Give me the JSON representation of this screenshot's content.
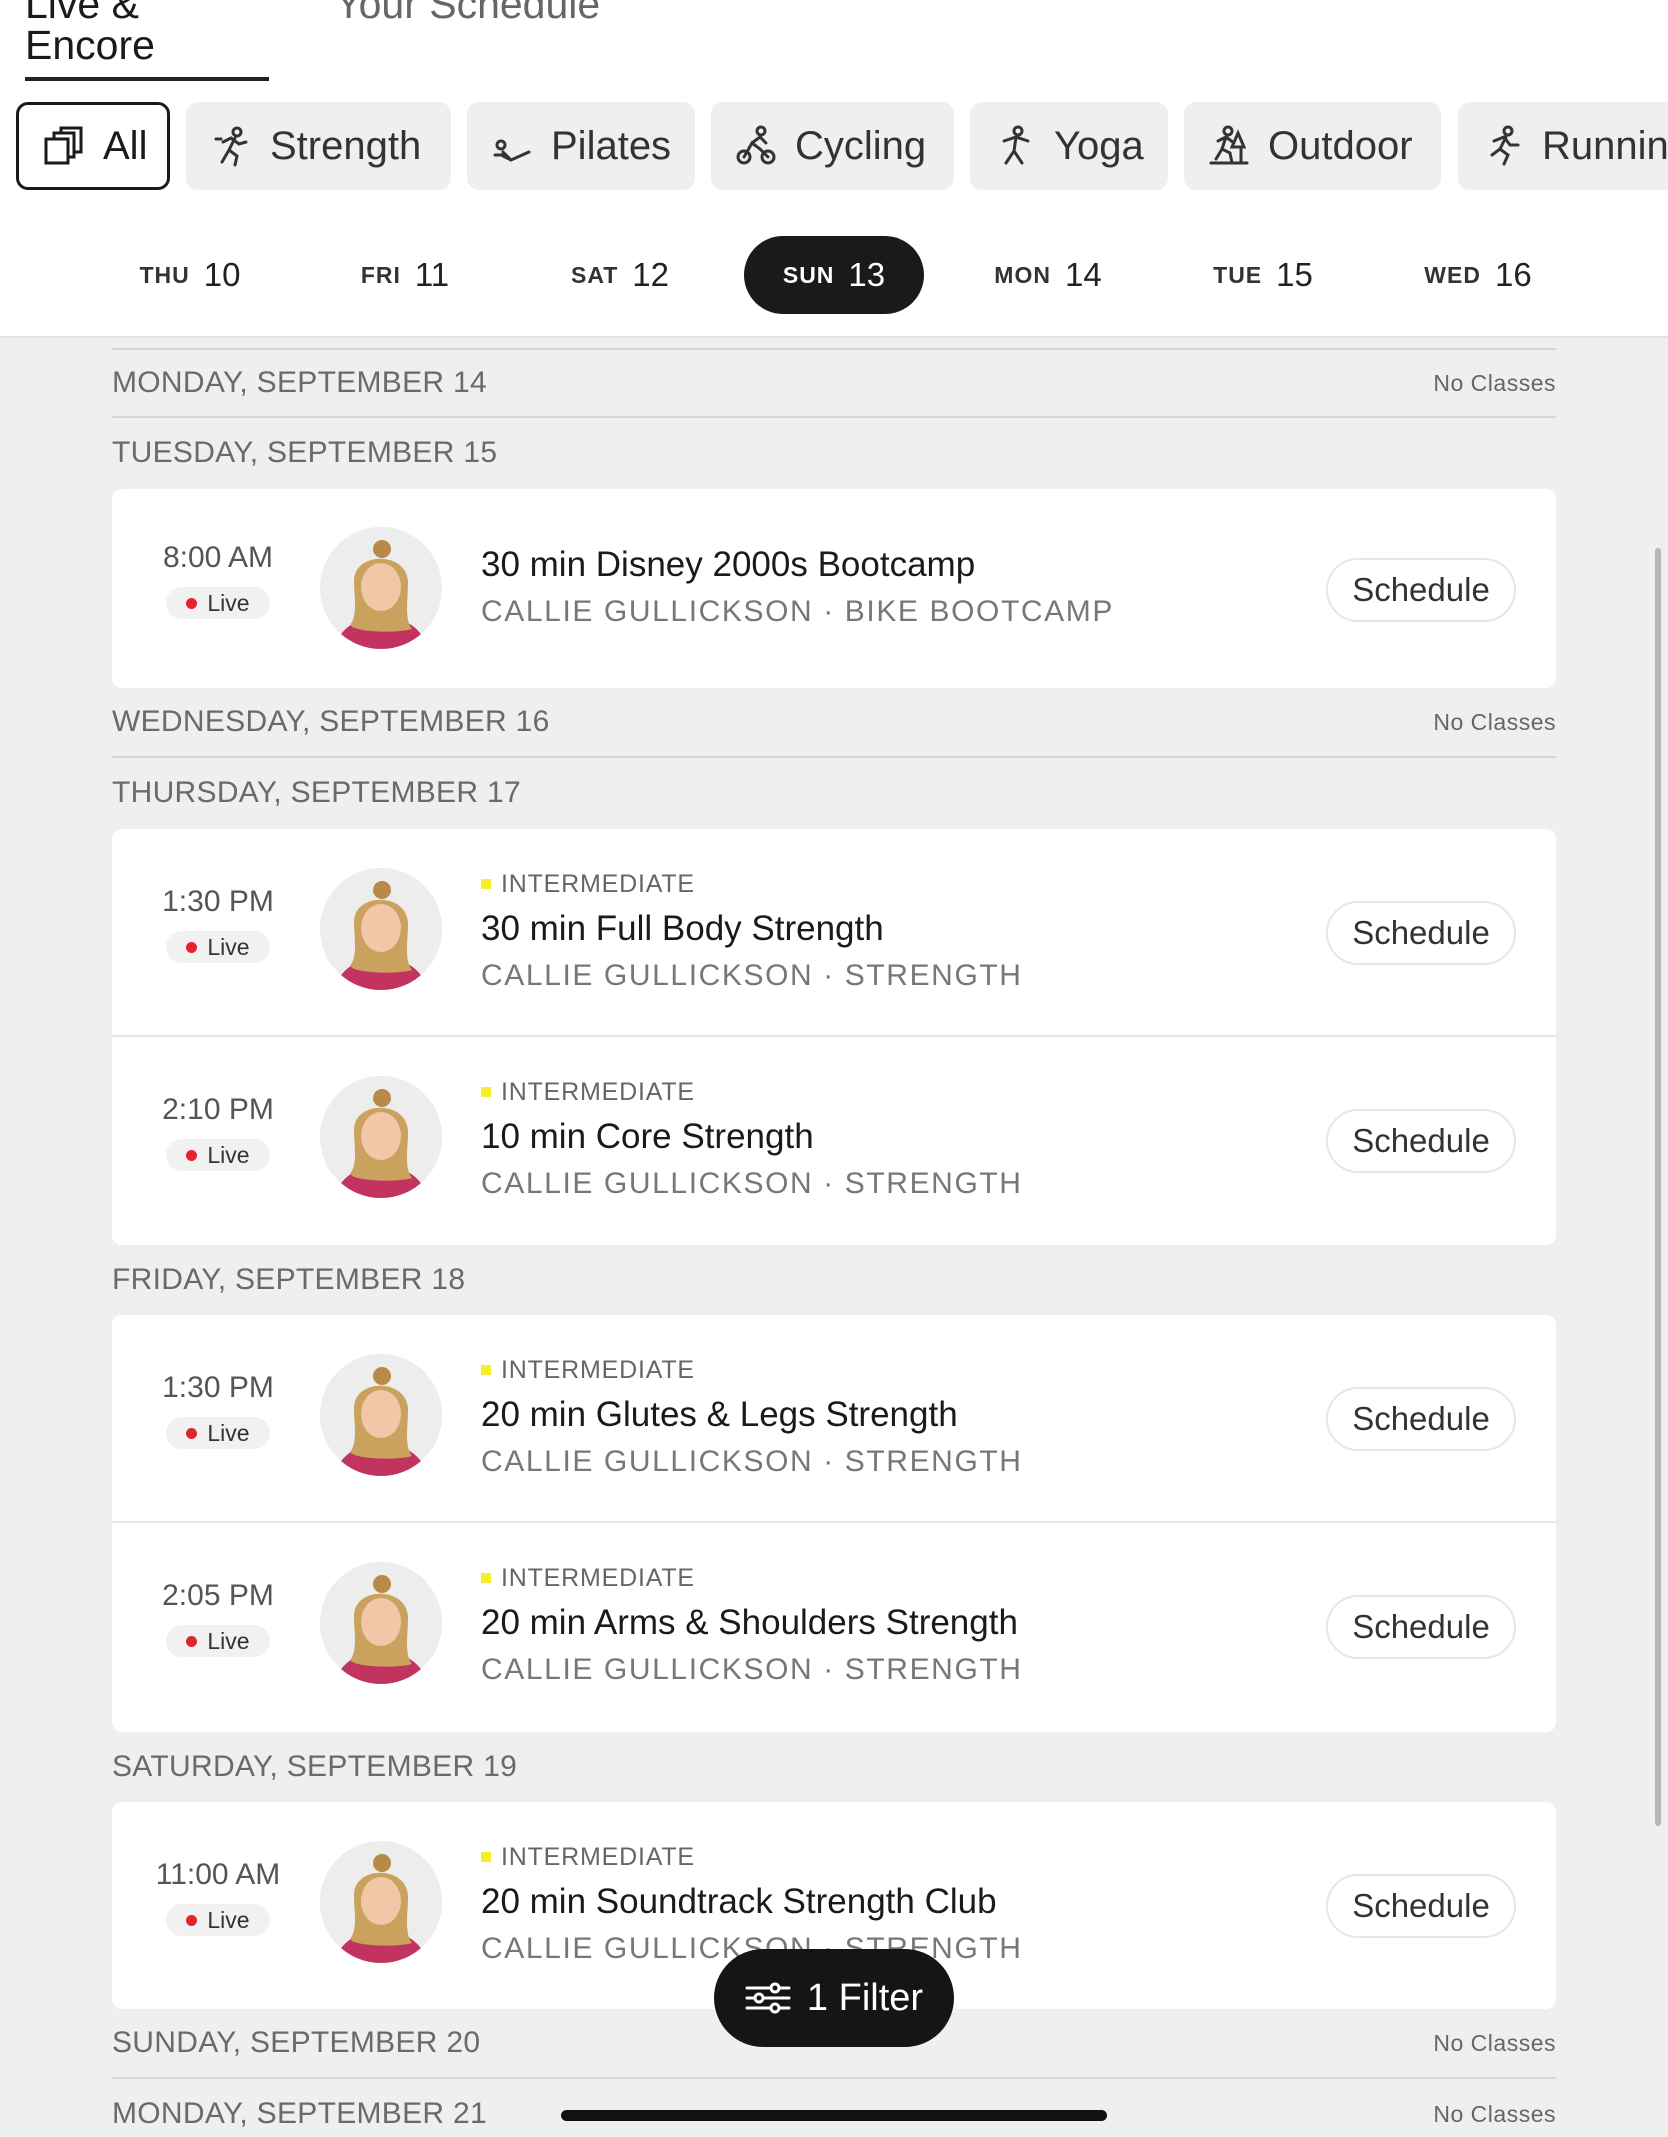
{
  "top_tabs": [
    {
      "label": "Live & Encore",
      "active": true
    },
    {
      "label": "Your Schedule",
      "active": false
    }
  ],
  "categories": [
    {
      "label": "All",
      "icon": "stacked-squares-icon",
      "active": true
    },
    {
      "label": "Strength",
      "icon": "strength-person-icon",
      "active": false
    },
    {
      "label": "Pilates",
      "icon": "pilates-person-icon",
      "active": false
    },
    {
      "label": "Cycling",
      "icon": "cycling-person-icon",
      "active": false
    },
    {
      "label": "Yoga",
      "icon": "yoga-person-icon",
      "active": false
    },
    {
      "label": "Outdoor",
      "icon": "outdoor-person-icon",
      "active": false
    },
    {
      "label": "Running",
      "icon": "running-person-icon",
      "active": false
    }
  ],
  "days": [
    {
      "dow": "THU",
      "num": "10",
      "selected": false
    },
    {
      "dow": "FRI",
      "num": "11",
      "selected": false
    },
    {
      "dow": "SAT",
      "num": "12",
      "selected": false
    },
    {
      "dow": "SUN",
      "num": "13",
      "selected": true
    },
    {
      "dow": "MON",
      "num": "14",
      "selected": false
    },
    {
      "dow": "TUE",
      "num": "15",
      "selected": false
    },
    {
      "dow": "WED",
      "num": "16",
      "selected": false
    }
  ],
  "schedule_label": "Schedule",
  "live_label": "Live",
  "no_classes_label": "No Classes",
  "sections": [
    {
      "day": "MONDAY, SEPTEMBER 14",
      "no_classes": true,
      "classes": []
    },
    {
      "day": "TUESDAY, SEPTEMBER 15",
      "no_classes": false,
      "classes": [
        {
          "time": "8:00 AM",
          "level": "",
          "title": "30 min Disney 2000s Bootcamp",
          "meta": "CALLIE GULLICKSON · BIKE BOOTCAMP"
        }
      ]
    },
    {
      "day": "WEDNESDAY, SEPTEMBER 16",
      "no_classes": true,
      "classes": []
    },
    {
      "day": "THURSDAY, SEPTEMBER 17",
      "no_classes": false,
      "classes": [
        {
          "time": "1:30 PM",
          "level": "INTERMEDIATE",
          "title": "30 min Full Body Strength",
          "meta": "CALLIE GULLICKSON · STRENGTH"
        },
        {
          "time": "2:10 PM",
          "level": "INTERMEDIATE",
          "title": "10 min Core Strength",
          "meta": "CALLIE GULLICKSON · STRENGTH"
        }
      ]
    },
    {
      "day": "FRIDAY, SEPTEMBER 18",
      "no_classes": false,
      "classes": [
        {
          "time": "1:30 PM",
          "level": "INTERMEDIATE",
          "title": "20 min Glutes & Legs Strength",
          "meta": "CALLIE GULLICKSON · STRENGTH"
        },
        {
          "time": "2:05 PM",
          "level": "INTERMEDIATE",
          "title": "20 min Arms & Shoulders Strength",
          "meta": "CALLIE GULLICKSON · STRENGTH"
        }
      ]
    },
    {
      "day": "SATURDAY, SEPTEMBER 19",
      "no_classes": false,
      "classes": [
        {
          "time": "11:00 AM",
          "level": "INTERMEDIATE",
          "title": "20 min Soundtrack Strength Club",
          "meta": "CALLIE GULLICKSON · STRENGTH"
        }
      ]
    },
    {
      "day": "SUNDAY, SEPTEMBER 20",
      "no_classes": true,
      "classes": []
    },
    {
      "day": "MONDAY, SEPTEMBER 21",
      "no_classes": true,
      "classes": []
    }
  ],
  "filter_button": {
    "label": "1 Filter",
    "icon": "sliders-icon"
  },
  "colors": {
    "accent_dark": "#1a1a1a",
    "live_dot": "#e0262b",
    "level_marker": "#f2ee2c",
    "background": "#efeff0"
  }
}
